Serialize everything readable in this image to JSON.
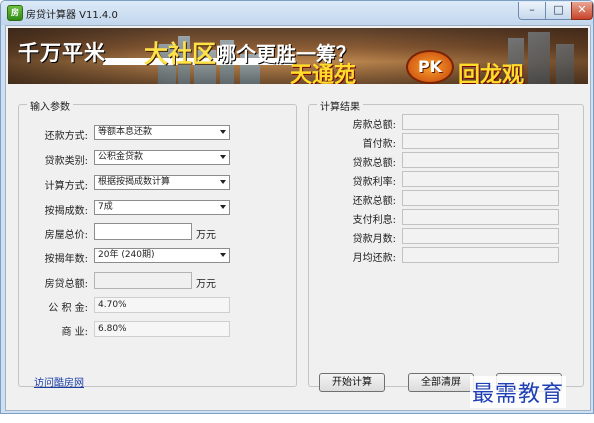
{
  "window": {
    "title": "房贷计算器 V11.4.0",
    "app_icon_text": "房"
  },
  "banner": {
    "text1": "千万平米",
    "text2": "大社区",
    "text3": "哪个更胜一筹？",
    "text4": "天通苑",
    "pk": "PK",
    "text5": "回龙观"
  },
  "input_group": {
    "title": "输入参数",
    "repayment_method": {
      "label": "还款方式:",
      "value": "等额本息还款"
    },
    "loan_type": {
      "label": "贷款类别:",
      "value": "公积金贷款"
    },
    "calc_method": {
      "label": "计算方式:",
      "value": "根据按揭成数计算"
    },
    "mortgage_ratio": {
      "label": "按揭成数:",
      "value": "7成"
    },
    "house_price": {
      "label": "房屋总价:",
      "value": "",
      "unit": "万元"
    },
    "mortgage_years": {
      "label": "按揭年数:",
      "value": "20年 (240期)"
    },
    "loan_total": {
      "label": "房贷总额:",
      "value": "",
      "unit": "万元"
    },
    "fund_rate": {
      "label": "公 积 金:",
      "value": "4.70%"
    },
    "commercial_rate": {
      "label": "商    业:",
      "value": "6.80%"
    }
  },
  "result_group": {
    "title": "计算结果",
    "rows": [
      {
        "label": "房款总额:",
        "value": ""
      },
      {
        "label": "首付款:",
        "value": ""
      },
      {
        "label": "贷款总额:",
        "value": ""
      },
      {
        "label": "贷款利率:",
        "value": ""
      },
      {
        "label": "还款总额:",
        "value": ""
      },
      {
        "label": "支付利息:",
        "value": ""
      },
      {
        "label": "贷款月数:",
        "value": ""
      },
      {
        "label": "月均还款:",
        "value": ""
      }
    ]
  },
  "footer": {
    "link": "访问酷房网",
    "start_button": "开始计算",
    "clear_button": "全部清屏",
    "third_button": ""
  },
  "watermark": "最需教育"
}
